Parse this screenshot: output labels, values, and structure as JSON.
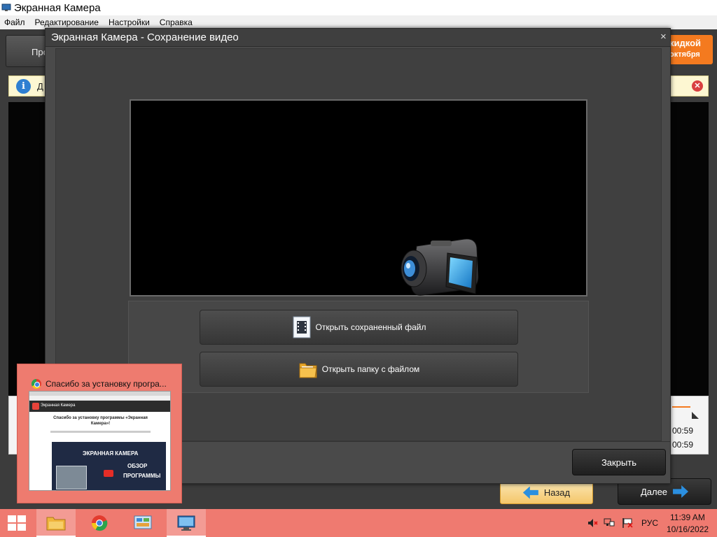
{
  "app": {
    "title": "Экранная Камера",
    "menu": [
      "Файл",
      "Редактирование",
      "Настройки",
      "Справка"
    ],
    "back_tab_label": "Про",
    "promo": {
      "line1": "кидкой",
      "line2": "октября",
      "color": "#f47a1f"
    },
    "info_text": "Д",
    "times": [
      "00:59",
      "00:59"
    ],
    "back_button": "Назад",
    "next_button": "Далее"
  },
  "dialog": {
    "title": "Экранная Камера - Сохранение видео",
    "close_symbol": "×",
    "open_file_button": "Открыть сохраненный файл",
    "open_folder_button": "Открыть папку с файлом",
    "close_button": "Закрыть"
  },
  "thumbnail": {
    "title": "Спасибо за установку програ...",
    "page_brand": "Экранная Камера",
    "page_heading": "Спасибо за установку программы «Экранная Камера»!",
    "video_title": "ЭКРАННАЯ КАМЕРА",
    "video_line2": "ОБЗОР",
    "video_line3": "ПРОГРАММЫ"
  },
  "taskbar": {
    "language": "РУС",
    "time": "11:39 AM",
    "date": "10/16/2022",
    "apps": [
      "file-explorer",
      "chrome",
      "control-panel",
      "screen-camera"
    ],
    "accent_color": "#ef7a70"
  }
}
